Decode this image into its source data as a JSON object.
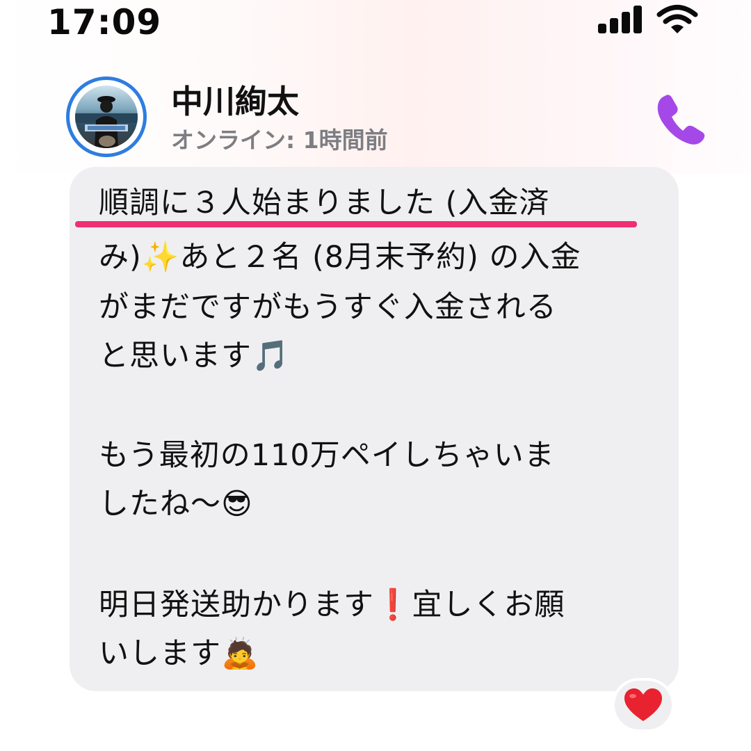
{
  "status_bar": {
    "time": "17:09",
    "signal_icon": "cellular-signal-icon",
    "wifi_icon": "wifi-icon"
  },
  "chat_header": {
    "contact_name": "中川絢太",
    "presence": "オンライン: 1時間前",
    "call_icon": "phone-icon",
    "call_color": "#a548e8",
    "avatar_ring_color": "#2e7de0"
  },
  "message": {
    "lines": [
      "順調に３人始まりました (入金済",
      "み)✨あと２名 (8月末予約) の入金",
      "がまだですがもうすぐ入金される",
      "と思います🎵",
      "もう最初の110万ペイしちゃいま",
      "したね〜😎",
      "明日発送助かります❗️宜しくお願",
      "いします🙇"
    ],
    "highlight_color": "#ee2f72",
    "bubble_color": "#efeff1"
  },
  "reaction": {
    "emoji": "❤️"
  }
}
